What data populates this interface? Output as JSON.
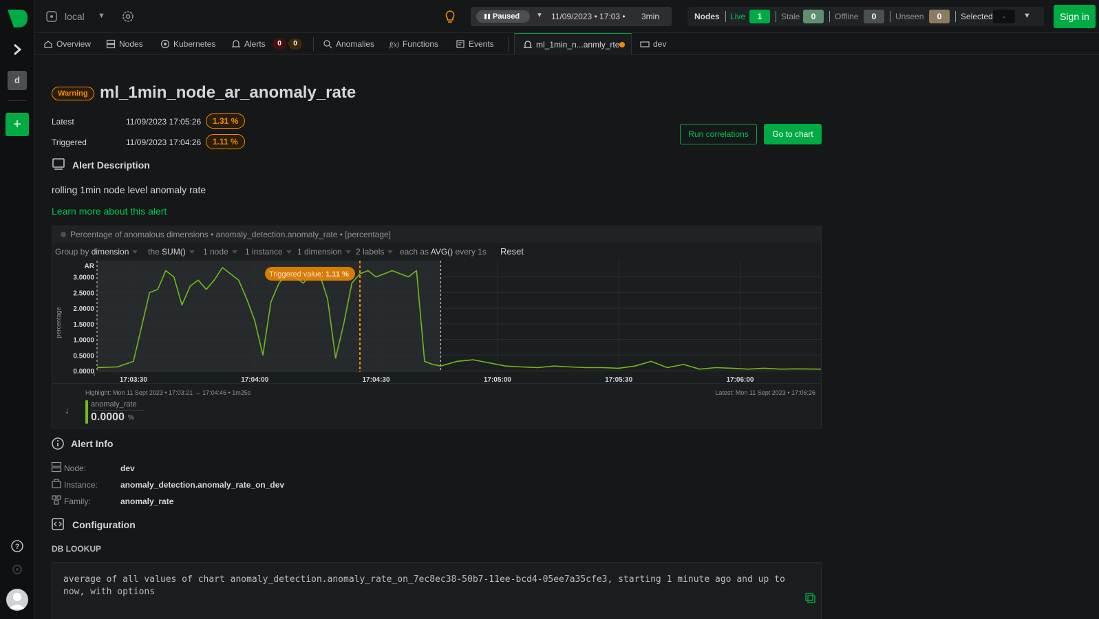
{
  "workspace": {
    "name": "local"
  },
  "timebar": {
    "state": "Paused",
    "date": "11/09/2023 • 17:03 •",
    "duration": "3min"
  },
  "nodes": {
    "title": "Nodes",
    "live_label": "Live",
    "live": "1",
    "stale_label": "Stale",
    "stale": "0",
    "offline_label": "Offline",
    "offline": "0",
    "unseen_label": "Unseen",
    "unseen": "0",
    "selected_label": "Selected",
    "selected": "-"
  },
  "signin": "Sign in",
  "rail": {
    "space_initial": "d",
    "add_label": "+"
  },
  "tabs": {
    "overview": "Overview",
    "nodes": "Nodes",
    "kubernetes": "Kubernetes",
    "alerts": "Alerts",
    "alerts_critical": "0",
    "alerts_warning": "0",
    "anomalies": "Anomalies",
    "functions": "Functions",
    "events": "Events",
    "alert_tab": "ml_1min_n...anmly_rte",
    "dev": "dev"
  },
  "alert": {
    "status": "Warning",
    "name": "ml_1min_node_ar_anomaly_rate",
    "latest_label": "Latest",
    "latest_time": "11/09/2023 17:05:26",
    "latest_value": "1.31 %",
    "triggered_label": "Triggered",
    "triggered_time": "11/09/2023 17:04:26",
    "triggered_value": "1.11 %",
    "run_correlations": "Run correlations",
    "go_to_chart": "Go to chart",
    "desc_title": "Alert Description",
    "description": "rolling 1min node level anomaly rate",
    "learn_more": "Learn more about this alert"
  },
  "chart": {
    "header": "Percentage of anomalous dimensions • anomaly_detection.anomaly_rate • [percentage]",
    "controls": {
      "group_by": "Group by",
      "group_by_val": "dimension",
      "the": "the",
      "agg": "SUM()",
      "nodes": "1 node",
      "instances": "1 instance",
      "dimensions": "1 dimension",
      "labels": "2 labels",
      "each_as": "each as",
      "each_agg": "AVG()",
      "every": "every 1s",
      "reset": "Reset"
    },
    "triggered_label": "Triggered value:",
    "triggered_val": "1.11 %",
    "highlight": "Highlight: Mon 11 Sept 2023 • 17:03:21 → 17:04:46 • 1m25s",
    "latest": "Latest: Mon 11 Sept 2023 • 17:06:26",
    "dimension_name": "anomaly_rate",
    "dimension_value": "0.0000",
    "dimension_unit": "%",
    "info_glyph": "i"
  },
  "chart_data": {
    "type": "line",
    "title": "",
    "xlabel": "",
    "ylabel": "percentage",
    "y_unit_label": "AR",
    "x_ticks": [
      "17:03:30",
      "17:04:00",
      "17:04:30",
      "17:05:00",
      "17:05:30",
      "17:06:00"
    ],
    "y_ticks": [
      "0.0000",
      "0.5000",
      "1.0000",
      "1.5000",
      "2.0000",
      "2.5000",
      "3.0000"
    ],
    "ylim": [
      0,
      3.3
    ],
    "x_range_seconds": [
      -9,
      170
    ],
    "highlight_range_seconds": [
      -9,
      76
    ],
    "triggered_at_seconds": 56,
    "grid": true,
    "series": [
      {
        "name": "anomaly_rate",
        "color": "#6fba1c",
        "x": [
          -9,
          -4,
          0,
          4,
          6,
          8,
          10,
          12,
          14,
          16,
          18,
          20,
          22,
          24,
          26,
          28,
          30,
          32,
          34,
          36,
          38,
          40,
          42,
          44,
          46,
          48,
          50,
          52,
          54,
          56,
          58,
          60,
          62,
          64,
          66,
          68,
          70,
          72,
          74,
          76,
          80,
          84,
          88,
          92,
          96,
          100,
          104,
          108,
          112,
          116,
          120,
          124,
          128,
          132,
          136,
          140,
          144,
          148,
          152,
          156,
          160,
          164,
          170
        ],
        "y": [
          0.1,
          0.12,
          0.3,
          2.5,
          2.6,
          3.2,
          3.0,
          2.1,
          2.7,
          2.9,
          2.6,
          2.9,
          3.3,
          3.1,
          2.9,
          2.3,
          1.6,
          0.5,
          2.2,
          2.8,
          3.1,
          3.0,
          2.8,
          3.1,
          3.1,
          2.3,
          0.4,
          1.5,
          2.8,
          3.1,
          3.2,
          3.0,
          3.1,
          3.2,
          3.1,
          3.0,
          3.2,
          0.3,
          0.2,
          0.15,
          0.3,
          0.35,
          0.25,
          0.15,
          0.12,
          0.1,
          0.15,
          0.12,
          0.1,
          0.1,
          0.08,
          0.15,
          0.3,
          0.1,
          0.2,
          0.05,
          0.1,
          0.08,
          0.05,
          0.08,
          0.05,
          0.06,
          0.05
        ]
      }
    ]
  },
  "info": {
    "title": "Alert Info",
    "node_label": "Node:",
    "node": "dev",
    "instance_label": "Instance:",
    "instance": "anomaly_detection.anomaly_rate_on_dev",
    "family_label": "Family:",
    "family": "anomaly_rate"
  },
  "config": {
    "title": "Configuration",
    "db_title": "DB LOOKUP",
    "lookup": "average of all values of chart anomaly_detection.anomaly_rate_on_7ec8ec38-50b7-11ee-bcd4-05ee7a35cfe3, starting 1 minute ago and up to now, with options"
  },
  "colors": {
    "brand": "#00ab44",
    "warning": "#f48b03",
    "series": "#6fba1c",
    "background": "#151718"
  }
}
